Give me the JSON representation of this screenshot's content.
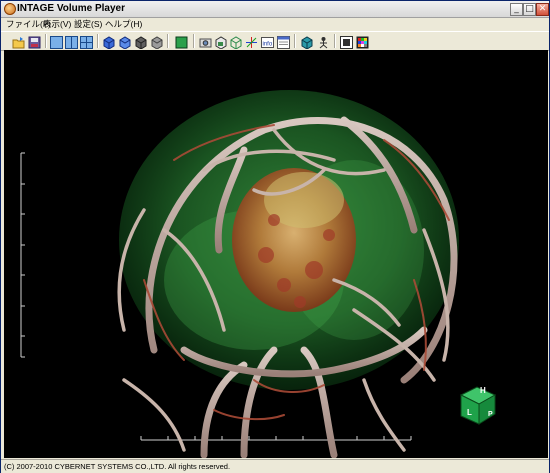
{
  "window": {
    "title": "INTAGE Volume Player",
    "minimize_glyph": "_",
    "maximize_glyph": "□",
    "close_glyph": "✕"
  },
  "menu": {
    "items": [
      "ファイル(F)",
      "表示(V)",
      "設定(S)",
      "ヘルプ(H)"
    ]
  },
  "toolbar": {
    "icons": [
      "open-folder-icon",
      "save-icon",
      "layout-single-icon",
      "layout-split-icon",
      "layout-quad-icon",
      "cube-blue-icon",
      "cube-blue-outline-icon",
      "cube-gray-icon",
      "cube-gray-light-icon",
      "green-square-icon",
      "camera-icon",
      "print-icon",
      "cube-wire-icon",
      "axes-icon",
      "info-icon",
      "window-icon",
      "cube-teal-icon",
      "person-icon",
      "screen-icon",
      "palette-icon"
    ]
  },
  "orientation_cube": {
    "top_label": "H",
    "left_label": "L",
    "right_label": "P",
    "color": "#1fa24a"
  },
  "status": {
    "text": "(C) 2007-2010 CYBERNET SYSTEMS CO.,LTD. All rights reserved."
  },
  "colors": {
    "background": "#000000",
    "vessel": "#b8a8a0",
    "vessel_red": "#a04030",
    "brain_green": "#2f8a3a",
    "tumor": "#b07a3a",
    "chrome": "#ece9d8"
  }
}
